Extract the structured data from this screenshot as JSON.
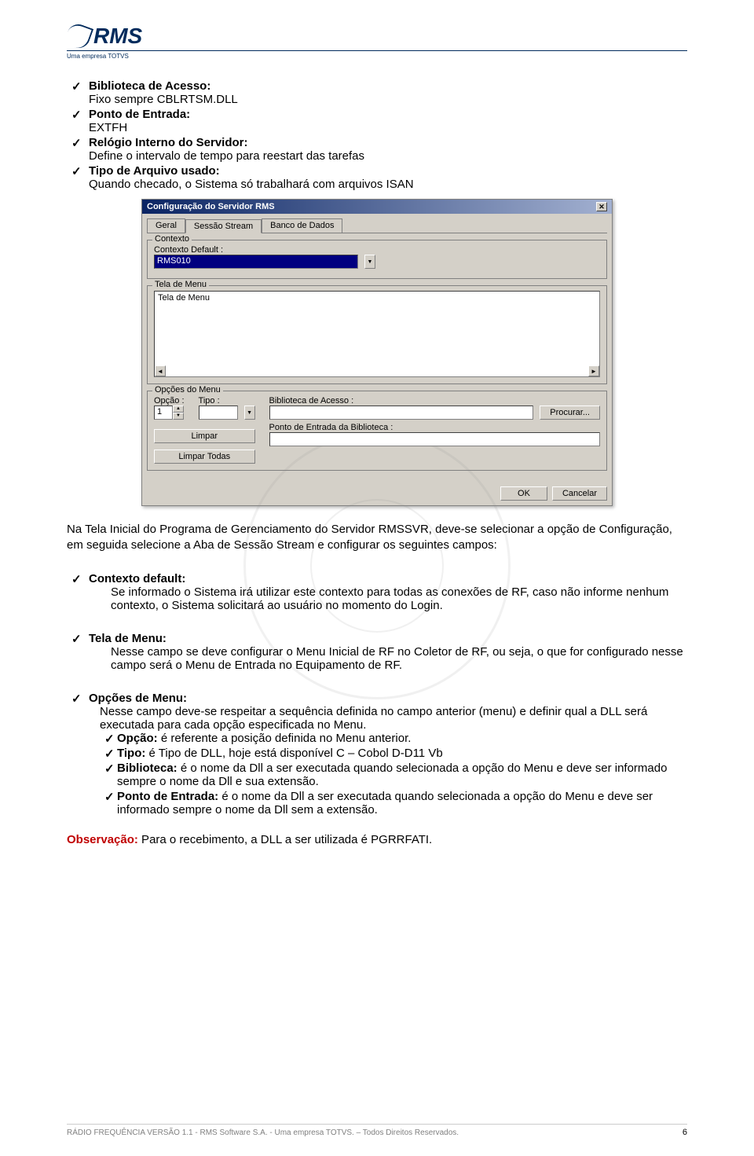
{
  "logo": {
    "name": "RMS",
    "subtitle": "Uma empresa TOTVS"
  },
  "top_list": {
    "items": [
      {
        "title": "Biblioteca de Acesso:",
        "body": "Fixo sempre CBLRTSM.DLL"
      },
      {
        "title": "Ponto de Entrada:",
        "body": "EXTFH"
      },
      {
        "title": "Relógio Interno do Servidor:",
        "body": "Define o intervalo de tempo para reestart das tarefas"
      },
      {
        "title": "Tipo de Arquivo usado:",
        "body": "Quando checado, o Sistema só trabalhará com arquivos ISAN"
      }
    ]
  },
  "dialog": {
    "title": "Configuração do Servidor RMS",
    "tabs": [
      "Geral",
      "Sessão Stream",
      "Banco de Dados"
    ],
    "contexto": {
      "legend": "Contexto",
      "label": "Contexto Default :",
      "value": "RMS010"
    },
    "tela_menu": {
      "legend": "Tela de Menu",
      "content": "Tela de Menu"
    },
    "opcoes": {
      "legend": "Opções do Menu",
      "opcao_label": "Opção :",
      "opcao_value": "1",
      "tipo_label": "Tipo :",
      "biblioteca_label": "Biblioteca de Acesso :",
      "ponto_label": "Ponto de Entrada da Biblioteca :",
      "procurar": "Procurar...",
      "limpar": "Limpar",
      "limpar_todas": "Limpar Todas"
    },
    "ok": "OK",
    "cancel": "Cancelar"
  },
  "para1": "Na Tela Inicial do Programa de Gerenciamento do Servidor RMSSVR, deve-se selecionar a opção de Configuração, em seguida selecione a Aba de Sessão Stream e configurar os seguintes campos:",
  "sections": {
    "contexto": {
      "title": "Contexto default:",
      "body": "Se informado o Sistema irá utilizar este contexto para todas as conexões de RF, caso não informe nenhum contexto, o Sistema solicitará ao usuário no momento do Login."
    },
    "tela": {
      "title": "Tela de Menu:",
      "body": "Nesse campo se deve configurar o Menu Inicial de RF no Coletor de RF, ou seja, o que for configurado nesse campo será o Menu de Entrada no Equipamento de RF."
    },
    "opcoes": {
      "title": "Opções de Menu:",
      "body": "Nesse campo deve-se respeitar a sequência definida no campo anterior (menu) e definir qual a DLL será executada para cada opção especificada no Menu.",
      "items": [
        {
          "label": "Opção:",
          "text": " é referente a posição definida no Menu anterior."
        },
        {
          "label": "Tipo:",
          "text": " é Tipo de DLL, hoje está disponível C – Cobol D-D11 Vb"
        },
        {
          "label": "Biblioteca:",
          "text": " é o nome da Dll a ser executada quando selecionada a opção do Menu e deve ser informado sempre o nome da Dll e sua extensão."
        },
        {
          "label": "Ponto de Entrada:",
          "text": " é o nome da Dll a ser executada quando selecionada a opção do Menu e deve ser informado sempre o nome da Dll sem a extensão."
        }
      ]
    }
  },
  "obs": {
    "label": "Observação:",
    "text": " Para o recebimento, a DLL a ser utilizada é PGRRFATI."
  },
  "footer": {
    "text": "RÁDIO FREQUÊNCIA VERSÃO 1.1  -  RMS Software S.A.   -  Uma empresa TOTVS. – Todos Direitos Reservados.",
    "page": "6"
  }
}
